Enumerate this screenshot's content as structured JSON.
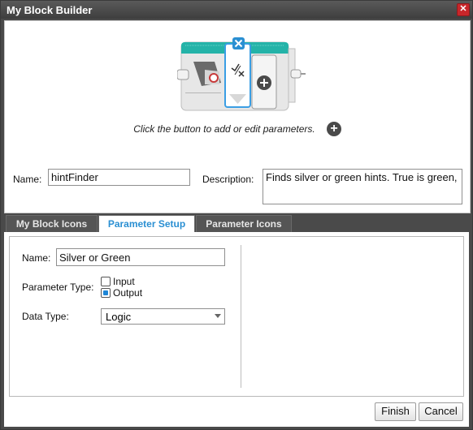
{
  "window": {
    "title": "My Block Builder"
  },
  "block_preview": {
    "hint": "Click the button to add or edit parameters."
  },
  "block": {
    "name_label": "Name:",
    "name_value": "hintFinder",
    "description_label": "Description:",
    "description_value": "Finds silver or green hints. True is green,"
  },
  "tabs": [
    {
      "label": "My Block Icons",
      "active": false
    },
    {
      "label": "Parameter Setup",
      "active": true
    },
    {
      "label": "Parameter Icons",
      "active": false
    }
  ],
  "parameter": {
    "name_label": "Name:",
    "name_value": "Silver or Green",
    "type_label": "Parameter Type:",
    "type_options": [
      {
        "label": "Input",
        "checked": false
      },
      {
        "label": "Output",
        "checked": true
      }
    ],
    "data_type_label": "Data Type:",
    "data_type_value": "Logic"
  },
  "buttons": {
    "finish": "Finish",
    "cancel": "Cancel"
  },
  "colors": {
    "accent": "#2a8fd2",
    "block_teal": "#24b3a8",
    "window_frame": "#4a4a4a"
  }
}
